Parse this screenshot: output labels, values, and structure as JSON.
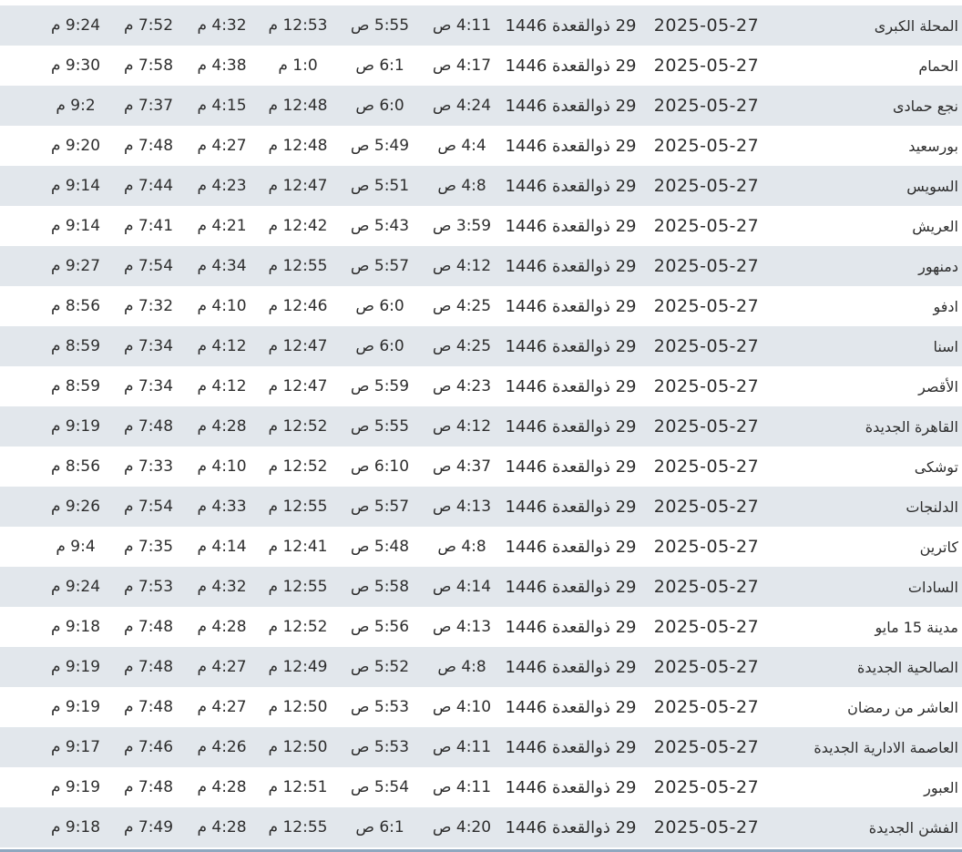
{
  "rows": [
    {
      "city": "المحلة الكبرى",
      "gregorian": "2025-05-27",
      "hijri": "29 ذوالقعدة 1446",
      "fajr": "4:11 ص",
      "sunrise": "5:55 ص",
      "dhuhr": "12:53 م",
      "asr": "4:32 م",
      "maghrib": "7:52 م",
      "isha": "9:24 م"
    },
    {
      "city": "الحمام",
      "gregorian": "2025-05-27",
      "hijri": "29 ذوالقعدة 1446",
      "fajr": "4:17 ص",
      "sunrise": "6:1 ص",
      "dhuhr": "1:0 م",
      "asr": "4:38 م",
      "maghrib": "7:58 م",
      "isha": "9:30 م"
    },
    {
      "city": "نجع حمادى",
      "gregorian": "2025-05-27",
      "hijri": "29 ذوالقعدة 1446",
      "fajr": "4:24 ص",
      "sunrise": "6:0 ص",
      "dhuhr": "12:48 م",
      "asr": "4:15 م",
      "maghrib": "7:37 م",
      "isha": "9:2 م"
    },
    {
      "city": "بورسعيد",
      "gregorian": "2025-05-27",
      "hijri": "29 ذوالقعدة 1446",
      "fajr": "4:4 ص",
      "sunrise": "5:49 ص",
      "dhuhr": "12:48 م",
      "asr": "4:27 م",
      "maghrib": "7:48 م",
      "isha": "9:20 م"
    },
    {
      "city": "السويس",
      "gregorian": "2025-05-27",
      "hijri": "29 ذوالقعدة 1446",
      "fajr": "4:8 ص",
      "sunrise": "5:51 ص",
      "dhuhr": "12:47 م",
      "asr": "4:23 م",
      "maghrib": "7:44 م",
      "isha": "9:14 م"
    },
    {
      "city": "العريش",
      "gregorian": "2025-05-27",
      "hijri": "29 ذوالقعدة 1446",
      "fajr": "3:59 ص",
      "sunrise": "5:43 ص",
      "dhuhr": "12:42 م",
      "asr": "4:21 م",
      "maghrib": "7:41 م",
      "isha": "9:14 م"
    },
    {
      "city": "دمنهور",
      "gregorian": "2025-05-27",
      "hijri": "29 ذوالقعدة 1446",
      "fajr": "4:12 ص",
      "sunrise": "5:57 ص",
      "dhuhr": "12:55 م",
      "asr": "4:34 م",
      "maghrib": "7:54 م",
      "isha": "9:27 م"
    },
    {
      "city": "ادفو",
      "gregorian": "2025-05-27",
      "hijri": "29 ذوالقعدة 1446",
      "fajr": "4:25 ص",
      "sunrise": "6:0 ص",
      "dhuhr": "12:46 م",
      "asr": "4:10 م",
      "maghrib": "7:32 م",
      "isha": "8:56 م"
    },
    {
      "city": "اسنا",
      "gregorian": "2025-05-27",
      "hijri": "29 ذوالقعدة 1446",
      "fajr": "4:25 ص",
      "sunrise": "6:0 ص",
      "dhuhr": "12:47 م",
      "asr": "4:12 م",
      "maghrib": "7:34 م",
      "isha": "8:59 م"
    },
    {
      "city": "الأقصر",
      "gregorian": "2025-05-27",
      "hijri": "29 ذوالقعدة 1446",
      "fajr": "4:23 ص",
      "sunrise": "5:59 ص",
      "dhuhr": "12:47 م",
      "asr": "4:12 م",
      "maghrib": "7:34 م",
      "isha": "8:59 م"
    },
    {
      "city": "القاهرة الجديدة",
      "gregorian": "2025-05-27",
      "hijri": "29 ذوالقعدة 1446",
      "fajr": "4:12 ص",
      "sunrise": "5:55 ص",
      "dhuhr": "12:52 م",
      "asr": "4:28 م",
      "maghrib": "7:48 م",
      "isha": "9:19 م"
    },
    {
      "city": "توشكى",
      "gregorian": "2025-05-27",
      "hijri": "29 ذوالقعدة 1446",
      "fajr": "4:37 ص",
      "sunrise": "6:10 ص",
      "dhuhr": "12:52 م",
      "asr": "4:10 م",
      "maghrib": "7:33 م",
      "isha": "8:56 م"
    },
    {
      "city": "الدلنجات",
      "gregorian": "2025-05-27",
      "hijri": "29 ذوالقعدة 1446",
      "fajr": "4:13 ص",
      "sunrise": "5:57 ص",
      "dhuhr": "12:55 م",
      "asr": "4:33 م",
      "maghrib": "7:54 م",
      "isha": "9:26 م"
    },
    {
      "city": "كاترين",
      "gregorian": "2025-05-27",
      "hijri": "29 ذوالقعدة 1446",
      "fajr": "4:8 ص",
      "sunrise": "5:48 ص",
      "dhuhr": "12:41 م",
      "asr": "4:14 م",
      "maghrib": "7:35 م",
      "isha": "9:4 م"
    },
    {
      "city": "السادات",
      "gregorian": "2025-05-27",
      "hijri": "29 ذوالقعدة 1446",
      "fajr": "4:14 ص",
      "sunrise": "5:58 ص",
      "dhuhr": "12:55 م",
      "asr": "4:32 م",
      "maghrib": "7:53 م",
      "isha": "9:24 م"
    },
    {
      "city": "مدينة 15 مايو",
      "gregorian": "2025-05-27",
      "hijri": "29 ذوالقعدة 1446",
      "fajr": "4:13 ص",
      "sunrise": "5:56 ص",
      "dhuhr": "12:52 م",
      "asr": "4:28 م",
      "maghrib": "7:48 م",
      "isha": "9:18 م"
    },
    {
      "city": "الصالحية الجديدة",
      "gregorian": "2025-05-27",
      "hijri": "29 ذوالقعدة 1446",
      "fajr": "4:8 ص",
      "sunrise": "5:52 ص",
      "dhuhr": "12:49 م",
      "asr": "4:27 م",
      "maghrib": "7:48 م",
      "isha": "9:19 م"
    },
    {
      "city": "العاشر من رمضان",
      "gregorian": "2025-05-27",
      "hijri": "29 ذوالقعدة 1446",
      "fajr": "4:10 ص",
      "sunrise": "5:53 ص",
      "dhuhr": "12:50 م",
      "asr": "4:27 م",
      "maghrib": "7:48 م",
      "isha": "9:19 م"
    },
    {
      "city": "العاصمة الادارية الجديدة",
      "gregorian": "2025-05-27",
      "hijri": "29 ذوالقعدة 1446",
      "fajr": "4:11 ص",
      "sunrise": "5:53 ص",
      "dhuhr": "12:50 م",
      "asr": "4:26 م",
      "maghrib": "7:46 م",
      "isha": "9:17 م"
    },
    {
      "city": "العبور",
      "gregorian": "2025-05-27",
      "hijri": "29 ذوالقعدة 1446",
      "fajr": "4:11 ص",
      "sunrise": "5:54 ص",
      "dhuhr": "12:51 م",
      "asr": "4:28 م",
      "maghrib": "7:48 م",
      "isha": "9:19 م"
    },
    {
      "city": "الفشن الجديدة",
      "gregorian": "2025-05-27",
      "hijri": "29 ذوالقعدة 1446",
      "fajr": "4:20 ص",
      "sunrise": "6:1 ص",
      "dhuhr": "12:55 م",
      "asr": "4:28 م",
      "maghrib": "7:49 م",
      "isha": "9:18 م"
    }
  ]
}
